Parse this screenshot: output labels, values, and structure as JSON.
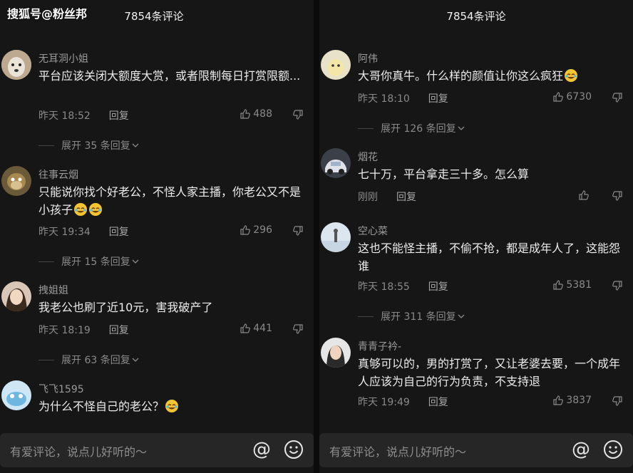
{
  "watermark": "搜狐号@粉丝邦",
  "left": {
    "header": "7854条评论",
    "comments": [
      {
        "user": "无耳洞小姐",
        "text": "平台应该关闭大额度大赏，或者限制每日打赏限额...",
        "time": "昨天 18:52",
        "reply": "回复",
        "likes": "488",
        "expand": "展开 35 条回复"
      },
      {
        "user": "往事云烟",
        "text": "只能说你找个好老公，不怪人家主播，你老公又不是小孩子",
        "time": "昨天 19:34",
        "reply": "回复",
        "likes": "296",
        "expand": "展开 15 条回复"
      },
      {
        "user": "拽姐姐",
        "text": "我老公也刷了近10元，害我破产了",
        "time": "昨天 18:19",
        "reply": "回复",
        "likes": "441",
        "expand": "展开 63 条回复"
      },
      {
        "user": "飞飞1595",
        "text": "为什么不怪自己的老公？"
      }
    ],
    "input_placeholder": "有爱评论，说点儿好听的～"
  },
  "right": {
    "header": "7854条评论",
    "comments": [
      {
        "user": "阿伟",
        "text": "大哥你真牛。什么样的颜值让你这么疯狂",
        "time": "昨天 18:10",
        "reply": "回复",
        "likes": "6730",
        "expand": "展开 126 条回复"
      },
      {
        "user": "烟花",
        "text": "七十万，平台拿走三十多。怎么算",
        "time": "刚刚",
        "reply": "回复",
        "likes": ""
      },
      {
        "user": "空心菜",
        "text": "这也不能怪主播，不偷不抢，都是成年人了，这能怨谁",
        "time": "昨天 18:55",
        "reply": "回复",
        "likes": "5381",
        "expand": "展开 311 条回复"
      },
      {
        "user": "青青子衿-",
        "text": "真够可以的，男的打赏了，又让老婆去要，一个成年人应该为自己的行为负责，不支持退",
        "time": "昨天 19:49",
        "reply": "回复",
        "likes": "3837"
      }
    ],
    "input_placeholder": "有爱评论，说点儿好听的～"
  },
  "icons": [
    "thumb-up-icon",
    "thumb-down-icon",
    "chevron-down-icon",
    "at-icon",
    "smiley-icon",
    "laughing-emoji-icon"
  ],
  "colors": {
    "background": "#161616",
    "text": "#ececec",
    "muted": "#8a8a8a",
    "input_bg": "#262626"
  }
}
